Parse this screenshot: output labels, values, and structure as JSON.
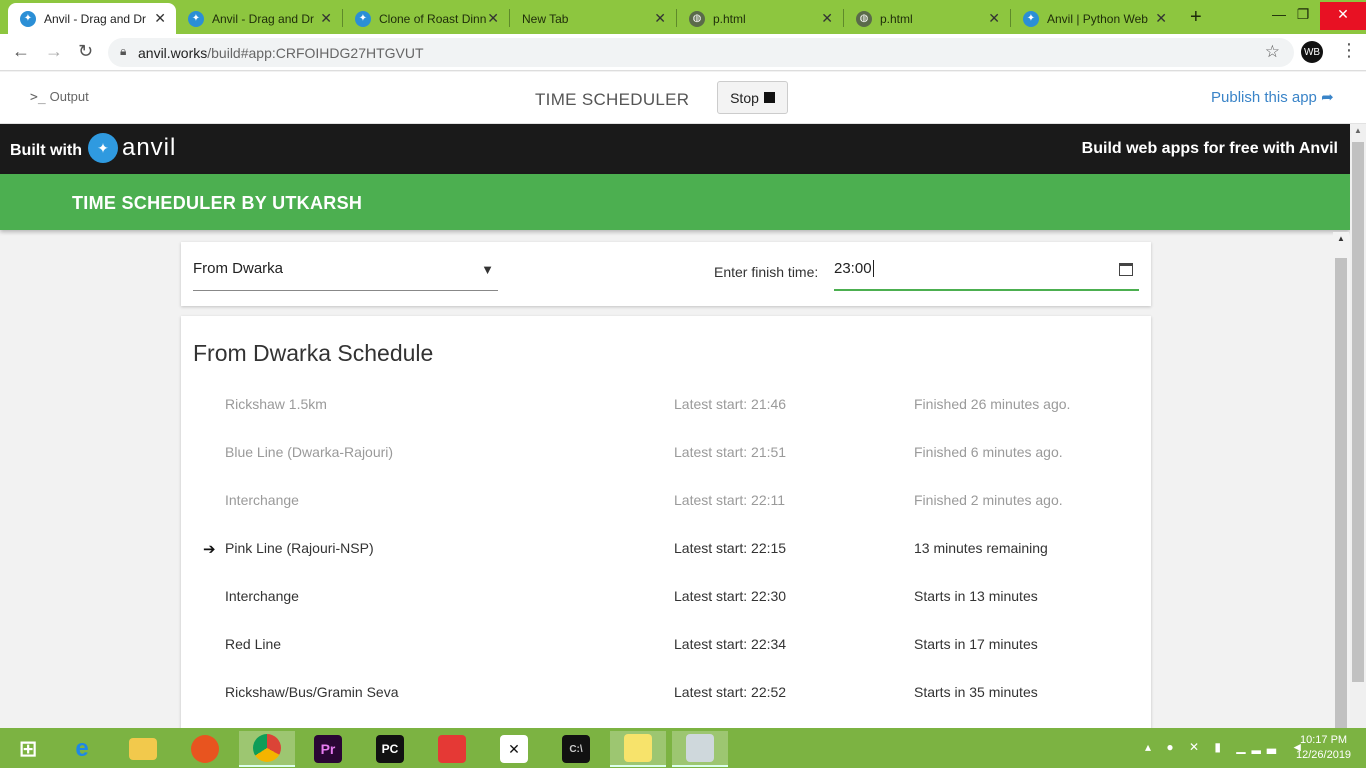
{
  "browser": {
    "tabs": [
      {
        "title": "Anvil - Drag and Dr",
        "icon": "anvil-icon",
        "active": true
      },
      {
        "title": "Anvil - Drag and Dr",
        "icon": "anvil-icon",
        "active": false
      },
      {
        "title": "Clone of Roast Dinn",
        "icon": "anvil-icon",
        "active": false
      },
      {
        "title": "New Tab",
        "icon": "",
        "active": false
      },
      {
        "title": "p.html",
        "icon": "globe-icon",
        "active": false
      },
      {
        "title": "p.html",
        "icon": "globe-icon",
        "active": false
      },
      {
        "title": "Anvil | Python Web",
        "icon": "anvil-icon",
        "active": false
      }
    ],
    "url_host": "anvil.works",
    "url_path": "/build#app:CRFOIHDG27HTGVUT"
  },
  "ide": {
    "output_label": "Output",
    "app_title": "TIME SCHEDULER",
    "stop_label": "Stop",
    "publish_label": "Publish this app"
  },
  "banner": {
    "built_with": "Built with",
    "brand": "anvil",
    "build_free": "Build web apps for free with Anvil"
  },
  "app": {
    "title": "TIME SCHEDULER BY UTKARSH",
    "origin_selected": "From Dwarka",
    "finish_label": "Enter finish time:",
    "finish_value": "23:00",
    "schedule_title": "From Dwarka Schedule",
    "rows": [
      {
        "name": "Rickshaw 1.5km",
        "start": "Latest start: 21:46",
        "status": "Finished 26 minutes ago.",
        "state": "past"
      },
      {
        "name": "Blue Line (Dwarka-Rajouri)",
        "start": "Latest start: 21:51",
        "status": "Finished 6 minutes ago.",
        "state": "past"
      },
      {
        "name": "Interchange",
        "start": "Latest start: 22:11",
        "status": "Finished 2 minutes ago.",
        "state": "past"
      },
      {
        "name": "Pink Line (Rajouri-NSP)",
        "start": "Latest start: 22:15",
        "status": "13 minutes remaining",
        "state": "current"
      },
      {
        "name": "Interchange",
        "start": "Latest start: 22:30",
        "status": "Starts in 13 minutes",
        "state": "future"
      },
      {
        "name": "Red Line",
        "start": "Latest start: 22:34",
        "status": "Starts in 17 minutes",
        "state": "future"
      },
      {
        "name": "Rickshaw/Bus/Gramin Seva",
        "start": "Latest start: 22:52",
        "status": "Starts in 35 minutes",
        "state": "future"
      }
    ]
  },
  "taskbar": {
    "time": "10:17 PM",
    "date": "12/26/2019"
  },
  "colors": {
    "tab_strip": "#8dc63f",
    "app_bar": "#4caf50",
    "banner": "#1a1a1a",
    "publish_link": "#3a84c8",
    "taskbar": "#7cb342"
  }
}
